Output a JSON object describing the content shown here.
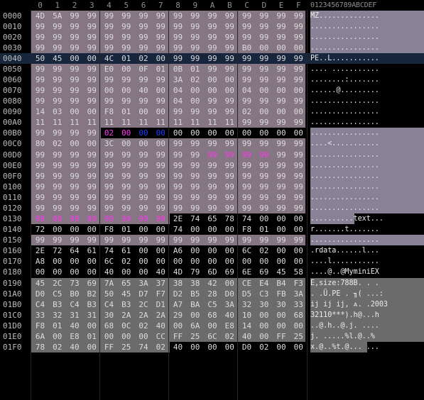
{
  "header": {
    "hex_cols": [
      "0",
      "1",
      "2",
      "3",
      "4",
      "5",
      "6",
      "7",
      "8",
      "9",
      "A",
      "B",
      "C",
      "D",
      "E",
      "F"
    ],
    "ascii_header": "0123456789ABCDEF"
  },
  "colors": {
    "background": "#000000",
    "selection_region": "#867683",
    "selection_region_dark": "#6b6b6b",
    "highlight_row": "#17253d",
    "address_text": "#bdbdbd",
    "hex_text": "#dcdcdc",
    "magenta_bytes": "#ff37f0",
    "blue_bytes": "#1c3cff"
  },
  "rows": [
    {
      "addr": "0000",
      "bytes": [
        "4D",
        "5A",
        "99",
        "99",
        "99",
        "99",
        "99",
        "99",
        "99",
        "99",
        "99",
        "99",
        "99",
        "99",
        "99",
        "99"
      ],
      "ascii": "MZ.............."
    },
    {
      "addr": "0010",
      "bytes": [
        "99",
        "99",
        "99",
        "99",
        "99",
        "99",
        "99",
        "99",
        "99",
        "99",
        "99",
        "99",
        "99",
        "99",
        "99",
        "99"
      ],
      "ascii": "................"
    },
    {
      "addr": "0020",
      "bytes": [
        "99",
        "99",
        "99",
        "99",
        "99",
        "99",
        "99",
        "99",
        "99",
        "99",
        "99",
        "99",
        "99",
        "99",
        "99",
        "99"
      ],
      "ascii": "................"
    },
    {
      "addr": "0030",
      "bytes": [
        "99",
        "99",
        "99",
        "99",
        "99",
        "99",
        "99",
        "99",
        "99",
        "99",
        "99",
        "99",
        "B0",
        "00",
        "00",
        "00"
      ],
      "ascii": "................"
    },
    {
      "addr": "0040",
      "bytes": [
        "50",
        "45",
        "00",
        "00",
        "4C",
        "01",
        "02",
        "00",
        "99",
        "99",
        "99",
        "99",
        "99",
        "99",
        "99",
        "99"
      ],
      "ascii": "PE..L..........."
    },
    {
      "addr": "0050",
      "bytes": [
        "99",
        "99",
        "99",
        "99",
        "E0",
        "00",
        "0F",
        "01",
        "0B",
        "01",
        "99",
        "99",
        "99",
        "99",
        "99",
        "99"
      ],
      "ascii": ".... ..........."
    },
    {
      "addr": "0060",
      "bytes": [
        "99",
        "99",
        "99",
        "99",
        "99",
        "99",
        "99",
        "99",
        "3A",
        "02",
        "00",
        "00",
        "99",
        "99",
        "99",
        "99"
      ],
      "ascii": "........:......."
    },
    {
      "addr": "0070",
      "bytes": [
        "99",
        "99",
        "99",
        "99",
        "00",
        "00",
        "40",
        "00",
        "04",
        "00",
        "00",
        "00",
        "04",
        "00",
        "00",
        "00"
      ],
      "ascii": "......@........."
    },
    {
      "addr": "0080",
      "bytes": [
        "99",
        "99",
        "99",
        "99",
        "99",
        "99",
        "99",
        "99",
        "04",
        "00",
        "99",
        "99",
        "99",
        "99",
        "99",
        "99"
      ],
      "ascii": "................"
    },
    {
      "addr": "0090",
      "bytes": [
        "14",
        "03",
        "00",
        "00",
        "F8",
        "01",
        "00",
        "00",
        "99",
        "99",
        "99",
        "99",
        "02",
        "00",
        "00",
        "00"
      ],
      "ascii": "................"
    },
    {
      "addr": "00A0",
      "bytes": [
        "11",
        "11",
        "11",
        "11",
        "11",
        "11",
        "11",
        "11",
        "11",
        "11",
        "11",
        "11",
        "99",
        "99",
        "99",
        "99"
      ],
      "ascii": "................"
    },
    {
      "addr": "00B0",
      "bytes": [
        "99",
        "99",
        "99",
        "99",
        "02",
        "00",
        "00",
        "00",
        "00",
        "00",
        "00",
        "00",
        "00",
        "00",
        "00",
        "00"
      ],
      "ascii": "................"
    },
    {
      "addr": "00C0",
      "bytes": [
        "80",
        "02",
        "00",
        "00",
        "3C",
        "00",
        "00",
        "00",
        "99",
        "99",
        "99",
        "99",
        "99",
        "99",
        "99",
        "99"
      ],
      "ascii": "....<..........."
    },
    {
      "addr": "00D0",
      "bytes": [
        "99",
        "99",
        "99",
        "99",
        "99",
        "99",
        "99",
        "99",
        "99",
        "99",
        "99",
        "99",
        "99",
        "99",
        "99",
        "99"
      ],
      "ascii": "................"
    },
    {
      "addr": "00E0",
      "bytes": [
        "99",
        "99",
        "99",
        "99",
        "99",
        "99",
        "99",
        "99",
        "99",
        "99",
        "99",
        "99",
        "99",
        "99",
        "99",
        "99"
      ],
      "ascii": "................"
    },
    {
      "addr": "00F0",
      "bytes": [
        "99",
        "99",
        "99",
        "99",
        "99",
        "99",
        "99",
        "99",
        "99",
        "99",
        "99",
        "99",
        "99",
        "99",
        "99",
        "99"
      ],
      "ascii": "................"
    },
    {
      "addr": "0100",
      "bytes": [
        "99",
        "99",
        "99",
        "99",
        "99",
        "99",
        "99",
        "99",
        "99",
        "99",
        "99",
        "99",
        "99",
        "99",
        "99",
        "99"
      ],
      "ascii": "................"
    },
    {
      "addr": "0110",
      "bytes": [
        "99",
        "99",
        "99",
        "99",
        "99",
        "99",
        "99",
        "99",
        "99",
        "99",
        "99",
        "99",
        "99",
        "99",
        "99",
        "99"
      ],
      "ascii": "................"
    },
    {
      "addr": "0120",
      "bytes": [
        "99",
        "99",
        "99",
        "99",
        "99",
        "99",
        "99",
        "99",
        "99",
        "99",
        "99",
        "99",
        "99",
        "99",
        "99",
        "99"
      ],
      "ascii": "................"
    },
    {
      "addr": "0130",
      "bytes": [
        "99",
        "99",
        "99",
        "99",
        "99",
        "99",
        "99",
        "99",
        "2E",
        "74",
        "65",
        "78",
        "74",
        "00",
        "00",
        "00"
      ],
      "ascii": "..........text..."
    },
    {
      "addr": "0140",
      "bytes": [
        "72",
        "00",
        "00",
        "00",
        "F8",
        "01",
        "00",
        "00",
        "74",
        "00",
        "00",
        "00",
        "F8",
        "01",
        "00",
        "00"
      ],
      "ascii": "r.......t......."
    },
    {
      "addr": "0150",
      "bytes": [
        "99",
        "99",
        "99",
        "99",
        "99",
        "99",
        "99",
        "99",
        "99",
        "99",
        "99",
        "99",
        "99",
        "99",
        "99",
        "99"
      ],
      "ascii": "................"
    },
    {
      "addr": "0160",
      "bytes": [
        "2E",
        "72",
        "64",
        "61",
        "74",
        "61",
        "00",
        "00",
        "A6",
        "00",
        "00",
        "00",
        "6C",
        "02",
        "00",
        "00"
      ],
      "ascii": ".rdata......l..."
    },
    {
      "addr": "0170",
      "bytes": [
        "A8",
        "00",
        "00",
        "00",
        "6C",
        "02",
        "00",
        "00",
        "00",
        "00",
        "00",
        "00",
        "00",
        "00",
        "00",
        "00"
      ],
      "ascii": "....l..........."
    },
    {
      "addr": "0180",
      "bytes": [
        "00",
        "00",
        "00",
        "00",
        "40",
        "00",
        "00",
        "40",
        "4D",
        "79",
        "6D",
        "69",
        "6E",
        "69",
        "45",
        "58"
      ],
      "ascii": "....@..@MyminiEX"
    },
    {
      "addr": "0190",
      "bytes": [
        "45",
        "2C",
        "73",
        "69",
        "7A",
        "65",
        "3A",
        "37",
        "38",
        "38",
        "42",
        "00",
        "CE",
        "E4",
        "B4",
        "F3"
      ],
      "ascii": "E,size:788B. . ."
    },
    {
      "addr": "01A0",
      "bytes": [
        "D0",
        "C5",
        "B0",
        "B2",
        "50",
        "45",
        "D7",
        "F7",
        "D2",
        "B5",
        "28",
        "D0",
        "D5",
        "C3",
        "FB",
        "3A"
      ],
      "ascii": ". .Ü.PE . ╖( ...:"
    },
    {
      "addr": "01B0",
      "bytes": [
        "C4",
        "B3",
        "C4",
        "B3",
        "C4",
        "B3",
        "2C",
        "D1",
        "A7",
        "BA",
        "C5",
        "3A",
        "32",
        "30",
        "30",
        "33"
      ],
      "ascii": "ij ij ij, ᴀ. .2003"
    },
    {
      "addr": "01C0",
      "bytes": [
        "33",
        "32",
        "31",
        "31",
        "30",
        "2A",
        "2A",
        "2A",
        "29",
        "00",
        "68",
        "40",
        "10",
        "00",
        "00",
        "68"
      ],
      "ascii": "32110***).h@...h"
    },
    {
      "addr": "01D0",
      "bytes": [
        "F8",
        "01",
        "40",
        "00",
        "68",
        "0C",
        "02",
        "40",
        "00",
        "6A",
        "00",
        "E8",
        "14",
        "00",
        "00",
        "00"
      ],
      "ascii": "..@.h..@.j. ...."
    },
    {
      "addr": "01E0",
      "bytes": [
        "6A",
        "00",
        "E8",
        "01",
        "00",
        "00",
        "00",
        "CC",
        "FF",
        "25",
        "6C",
        "02",
        "40",
        "00",
        "FF",
        "25"
      ],
      "ascii": "j. .....%l.@..%"
    },
    {
      "addr": "01F0",
      "bytes": [
        "78",
        "02",
        "40",
        "00",
        "FF",
        "25",
        "74",
        "02",
        "40",
        "00",
        "00",
        "00",
        "D0",
        "02",
        "00",
        "00"
      ],
      "ascii": "x.@..%t.@... ..."
    }
  ]
}
